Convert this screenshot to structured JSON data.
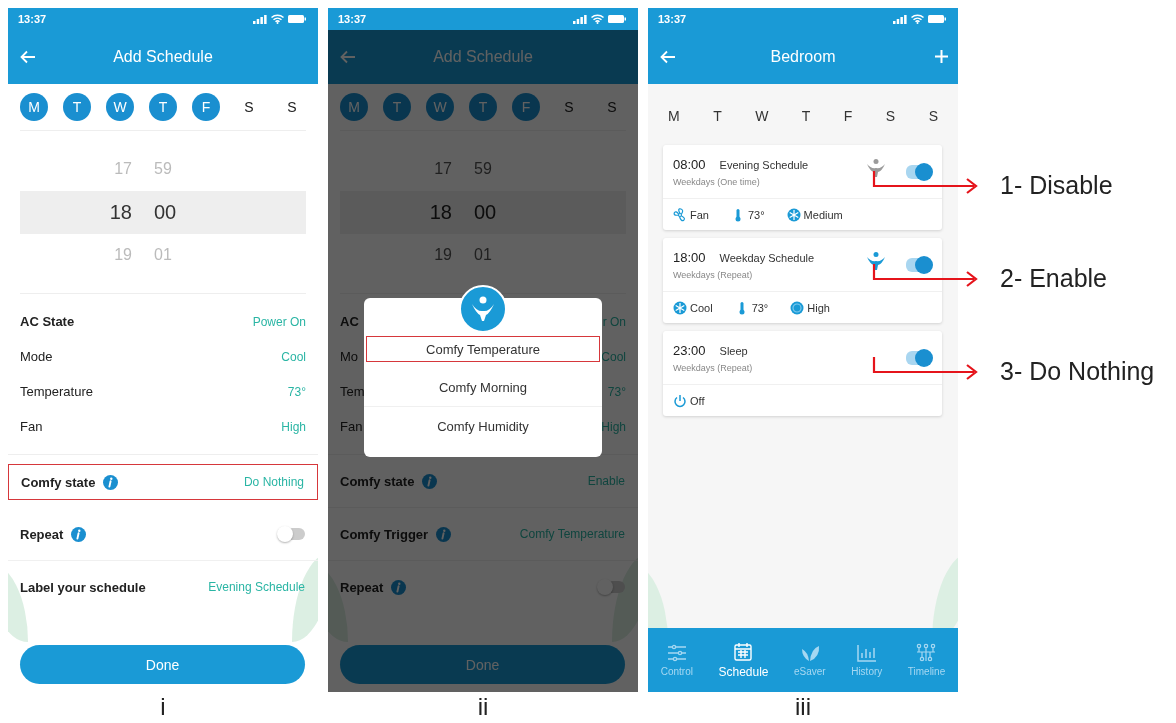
{
  "screens": [
    {
      "kind": "add_schedule",
      "time": "13:37",
      "title": "Add Schedule",
      "dimmed": false,
      "days": [
        {
          "label": "M",
          "selected": true
        },
        {
          "label": "T",
          "selected": true
        },
        {
          "label": "W",
          "selected": true
        },
        {
          "label": "T",
          "selected": true
        },
        {
          "label": "F",
          "selected": true
        },
        {
          "label": "S",
          "selected": false
        },
        {
          "label": "S",
          "selected": false
        }
      ],
      "picker": [
        {
          "hour": "17",
          "minute": "59",
          "selected": false
        },
        {
          "hour": "18",
          "minute": "00",
          "selected": true
        },
        {
          "hour": "19",
          "minute": "01",
          "selected": false
        }
      ],
      "settings": [
        {
          "label": "AC State",
          "value": "Power On"
        },
        {
          "label": "Mode",
          "value": "Cool"
        },
        {
          "label": "Temperature",
          "value": "73°"
        },
        {
          "label": "Fan",
          "value": "High"
        }
      ],
      "details": [
        {
          "kind": "value",
          "label": "Comfy state",
          "info": true,
          "value": "Do Nothing",
          "highlighted": true
        },
        {
          "kind": "toggle",
          "label": "Repeat",
          "info": true,
          "on": false,
          "highlighted": false
        },
        {
          "kind": "value",
          "label": "Label your schedule",
          "info": false,
          "value": "Evening Schedule",
          "highlighted": false
        }
      ],
      "done": "Done",
      "caption": "i"
    },
    {
      "kind": "add_schedule",
      "time": "13:37",
      "title": "Add Schedule",
      "dimmed": true,
      "days": [
        {
          "label": "M",
          "selected": true
        },
        {
          "label": "T",
          "selected": true
        },
        {
          "label": "W",
          "selected": true
        },
        {
          "label": "T",
          "selected": true
        },
        {
          "label": "F",
          "selected": true
        },
        {
          "label": "S",
          "selected": false
        },
        {
          "label": "S",
          "selected": false
        }
      ],
      "picker": [
        {
          "hour": "17",
          "minute": "59",
          "selected": false
        },
        {
          "hour": "18",
          "minute": "00",
          "selected": true
        },
        {
          "hour": "19",
          "minute": "01",
          "selected": false
        }
      ],
      "settings": [
        {
          "label": "AC",
          "value": "r On"
        },
        {
          "label": "Mo",
          "value": "Cool"
        },
        {
          "label": "Tem",
          "value": "73°"
        },
        {
          "label": "Fan",
          "value": "High"
        }
      ],
      "details": [
        {
          "kind": "value",
          "label": "Comfy state",
          "info": true,
          "value": "Enable",
          "highlighted": false
        },
        {
          "kind": "value",
          "label": "Comfy Trigger",
          "info": true,
          "value": "Comfy Temperature",
          "highlighted": false
        },
        {
          "kind": "toggle",
          "label": "Repeat",
          "info": true,
          "on": false,
          "highlighted": false
        }
      ],
      "modal": {
        "options": [
          {
            "label": "Comfy Temperature",
            "highlighted": true
          },
          {
            "label": "Comfy Morning",
            "highlighted": false
          },
          {
            "label": "Comfy Humidity",
            "highlighted": false
          }
        ]
      },
      "done": "Done",
      "caption": "ii"
    },
    {
      "kind": "schedule_list",
      "time": "13:37",
      "title": "Bedroom",
      "days": [
        "M",
        "T",
        "W",
        "T",
        "F",
        "S",
        "S"
      ],
      "schedules": [
        {
          "time": "08:00",
          "name": "Evening Schedule",
          "repeat": "Weekdays (One time)",
          "color": "#9b9b9b",
          "on": true,
          "annotation": "1- Disable",
          "details": [
            {
              "kind": "fan",
              "text": "Fan"
            },
            {
              "kind": "temperature",
              "text": "73°"
            },
            {
              "kind": "speed",
              "text": "Medium"
            }
          ]
        },
        {
          "time": "18:00",
          "name": "Weekday Schedule",
          "repeat": "Weekdays (Repeat)",
          "color": "#1a9ad6",
          "on": true,
          "annotation": "2- Enable",
          "details": [
            {
              "kind": "cool",
              "text": "Cool"
            },
            {
              "kind": "temperature",
              "text": "73°"
            },
            {
              "kind": "speed_high",
              "text": "High"
            }
          ]
        },
        {
          "time": "23:00",
          "name": "Sleep",
          "repeat": "Weekdays (Repeat)",
          "on": true,
          "annotation": "3- Do Nothing",
          "details": [
            {
              "kind": "power",
              "text": "Off"
            }
          ]
        }
      ],
      "nav": [
        {
          "kind": "control",
          "label": "Control",
          "selected": false
        },
        {
          "kind": "schedule",
          "label": "Schedule",
          "selected": true
        },
        {
          "kind": "esaver",
          "label": "eSaver",
          "selected": false
        },
        {
          "kind": "history",
          "label": "History",
          "selected": false
        },
        {
          "kind": "timeline",
          "label": "Timeline",
          "selected": false
        }
      ],
      "caption": "iii"
    }
  ]
}
